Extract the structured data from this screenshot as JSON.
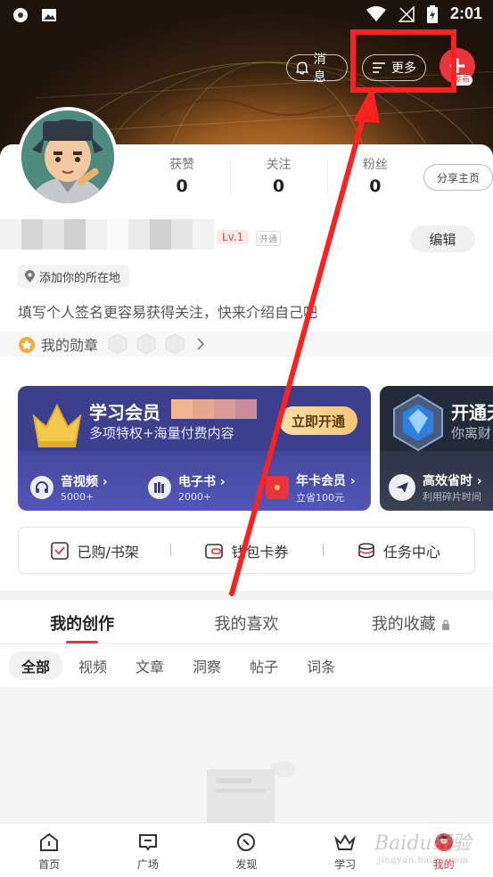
{
  "status_bar": {
    "time": "2:01"
  },
  "header": {
    "message_label": "消息",
    "more_label": "更多",
    "publish_badge": "发布"
  },
  "profile": {
    "stats": [
      {
        "label": "获赞",
        "value": "0"
      },
      {
        "label": "关注",
        "value": "0"
      },
      {
        "label": "粉丝",
        "value": "0"
      }
    ],
    "share_label": "分享主页",
    "level": "Lv.1",
    "open_badge": "开通",
    "edit_label": "编辑",
    "location_label": "添加你的所在地",
    "bio_placeholder": "填写个人签名更容易获得关注，快来介绍自己吧",
    "medal_label": "我的勋章"
  },
  "membership": {
    "title": "学习会员",
    "subtitle": "多项特权+海量付费内容",
    "open_button": "立即开通",
    "items": [
      {
        "title": "音视频",
        "sub": "5000+"
      },
      {
        "title": "电子书",
        "sub": "2000+"
      },
      {
        "title": "年卡会员",
        "sub": "立省100元"
      }
    ],
    "second_title": "开通天",
    "second_sub": "你离财",
    "second_item_title": "高效省时",
    "second_item_sub": "利用碎片时间"
  },
  "quick_actions": [
    {
      "label": "已购/书架"
    },
    {
      "label": "钱包卡券"
    },
    {
      "label": "任务中心"
    }
  ],
  "tabs": [
    {
      "label": "我的创作",
      "active": true
    },
    {
      "label": "我的喜欢",
      "active": false
    },
    {
      "label": "我的收藏",
      "active": false
    }
  ],
  "sub_tabs": [
    {
      "label": "全部",
      "active": true
    },
    {
      "label": "视频",
      "active": false
    },
    {
      "label": "文章",
      "active": false
    },
    {
      "label": "洞察",
      "active": false
    },
    {
      "label": "帖子",
      "active": false
    },
    {
      "label": "词条",
      "active": false
    }
  ],
  "bottom_nav": [
    {
      "label": "首页",
      "icon": "home-icon"
    },
    {
      "label": "广场",
      "icon": "square-chat-icon"
    },
    {
      "label": "发现",
      "icon": "compass-icon"
    },
    {
      "label": "学习",
      "icon": "crown-icon"
    },
    {
      "label": "我的",
      "icon": "profile-avatar-icon",
      "active": true
    }
  ],
  "watermark": {
    "text": "Baidu经验",
    "url": "jingyan.baidu.com"
  },
  "colors": {
    "accent": "#e8343c",
    "annotation": "#ff2020",
    "vip": "#3c3f8e",
    "gold": "#f2c676"
  }
}
